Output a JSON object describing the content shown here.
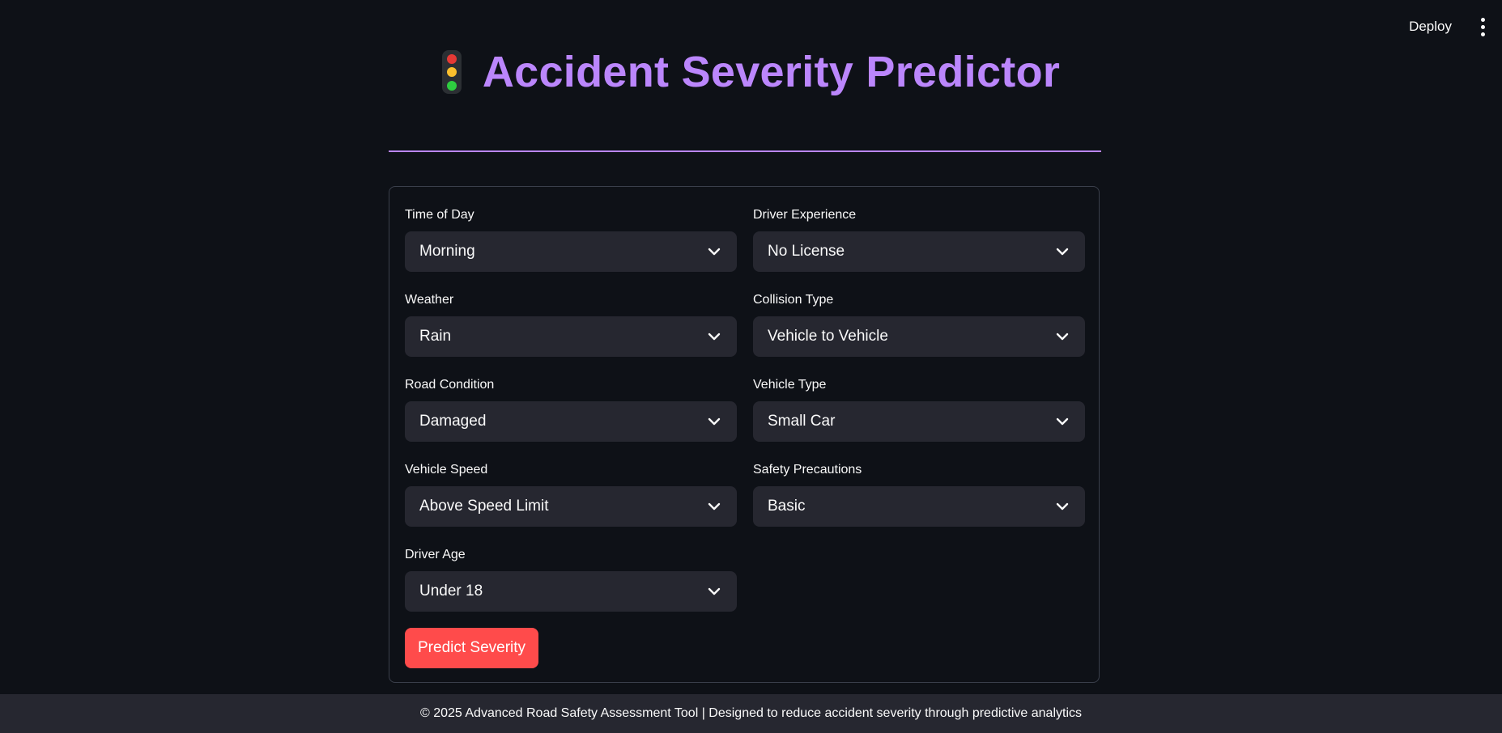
{
  "toolbar": {
    "deploy_label": "Deploy",
    "menu_icon": "more-vertical-icon"
  },
  "header": {
    "icon": "traffic-light-icon",
    "title": "Accident Severity Predictor",
    "title_color": "#bb86fc"
  },
  "form": {
    "fields": [
      {
        "label": "Time of Day",
        "value": "Morning"
      },
      {
        "label": "Driver Experience",
        "value": "No License"
      },
      {
        "label": "Weather",
        "value": "Rain"
      },
      {
        "label": "Collision Type",
        "value": "Vehicle to Vehicle"
      },
      {
        "label": "Road Condition",
        "value": "Damaged"
      },
      {
        "label": "Vehicle Type",
        "value": "Small Car"
      },
      {
        "label": "Vehicle Speed",
        "value": "Above Speed Limit"
      },
      {
        "label": "Safety Precautions",
        "value": "Basic"
      },
      {
        "label": "Driver Age",
        "value": "Under 18"
      }
    ],
    "submit_label": "Predict Severity"
  },
  "footer": {
    "text": "© 2025 Advanced Road Safety Assessment Tool | Designed to reduce accident severity through predictive analytics"
  },
  "colors": {
    "background": "#0e1117",
    "select_bg": "#262730",
    "accent": "#bb86fc",
    "button": "#ff4b4b"
  }
}
